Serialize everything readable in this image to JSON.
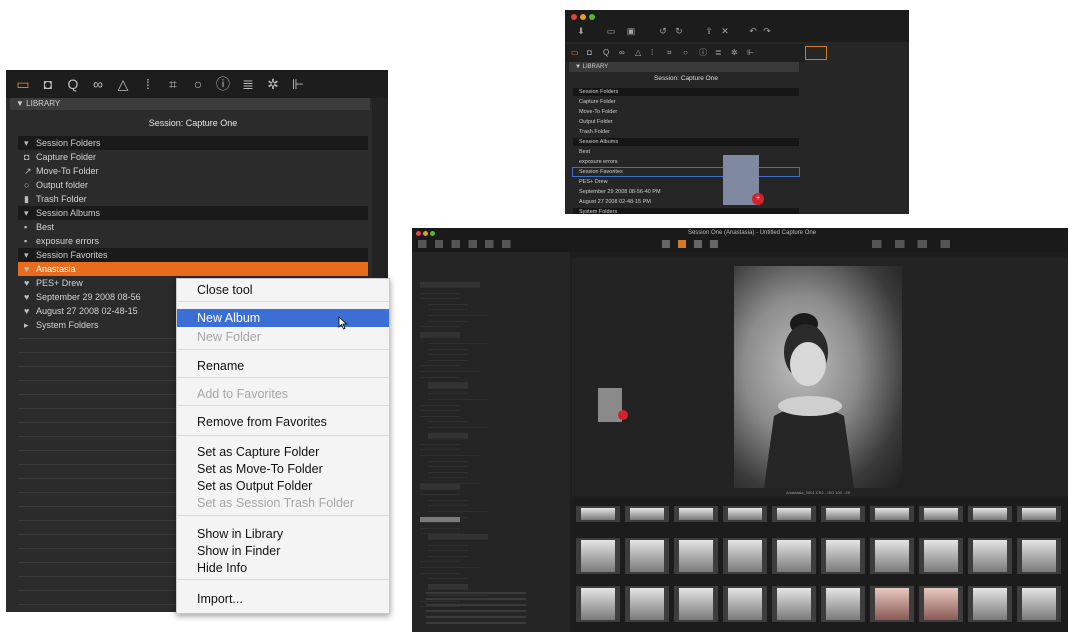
{
  "panel1": {
    "library_header": "▼ LIBRARY",
    "session_title": "Session: Capture One",
    "toolbar_icons": [
      "folder-icon",
      "camera-icon",
      "q-icon",
      "circles-icon",
      "triangle-icon",
      "pin-icon",
      "crop-icon",
      "chat-icon",
      "info-icon",
      "grid-icon",
      "gear-icon",
      "levels-icon"
    ],
    "rows": [
      {
        "label": "Session Folders",
        "kind": "group",
        "icon": "triangle-down-icon"
      },
      {
        "label": "Capture Folder",
        "kind": "item",
        "icon": "camera-icon"
      },
      {
        "label": "Move-To Folder",
        "kind": "item",
        "icon": "arrow-icon"
      },
      {
        "label": "Output folder",
        "kind": "item",
        "icon": "circle-icon"
      },
      {
        "label": "Trash Folder",
        "kind": "item",
        "icon": "trash-icon"
      },
      {
        "label": "Session Albums",
        "kind": "group",
        "icon": "triangle-down-icon"
      },
      {
        "label": "Best",
        "kind": "item",
        "icon": "album-icon"
      },
      {
        "label": "exposure errors",
        "kind": "item",
        "icon": "album-icon"
      },
      {
        "label": "Session Favorites",
        "kind": "group",
        "icon": "triangle-down-icon"
      },
      {
        "label": "Anastasia",
        "kind": "selected",
        "icon": "heart-icon"
      },
      {
        "label": "PES+ Drew",
        "kind": "item",
        "icon": "heart-icon"
      },
      {
        "label": "September 29 2008 08-56",
        "kind": "item",
        "icon": "heart-icon"
      },
      {
        "label": "August 27 2008 02-48-15",
        "kind": "item",
        "icon": "heart-icon"
      },
      {
        "label": "System Folders",
        "kind": "item",
        "icon": "triangle-right-icon"
      }
    ]
  },
  "context_menu": {
    "items": [
      {
        "label": "Close tool",
        "state": "normal"
      },
      {
        "label": "New Album",
        "state": "highlighted"
      },
      {
        "label": "New Folder",
        "state": "disabled"
      },
      {
        "label": "Rename",
        "state": "normal"
      },
      {
        "label": "Add to Favorites",
        "state": "disabled"
      },
      {
        "label": "Remove from Favorites",
        "state": "normal"
      },
      {
        "label": "Set as Capture Folder",
        "state": "normal"
      },
      {
        "label": "Set as Move-To Folder",
        "state": "normal"
      },
      {
        "label": "Set as Output Folder",
        "state": "normal"
      },
      {
        "label": "Set as Session Trash Folder",
        "state": "disabled"
      },
      {
        "label": "Show in Library",
        "state": "normal"
      },
      {
        "label": "Show in Finder",
        "state": "normal"
      },
      {
        "label": "Hide Info",
        "state": "normal"
      },
      {
        "label": "Import...",
        "state": "normal"
      }
    ]
  },
  "panel2": {
    "library_header": "▼ LIBRARY",
    "session_title": "Session: Capture One",
    "rows": [
      {
        "label": "Session Folders",
        "kind": "group"
      },
      {
        "label": "Capture Folder",
        "kind": "item"
      },
      {
        "label": "Move-To Folder",
        "kind": "item"
      },
      {
        "label": "Output Folder",
        "kind": "item"
      },
      {
        "label": "Trash Folder",
        "kind": "item"
      },
      {
        "label": "Session Albums",
        "kind": "group"
      },
      {
        "label": "Best",
        "kind": "item"
      },
      {
        "label": "exposure errors",
        "kind": "item"
      },
      {
        "label": "Session Favorites",
        "kind": "selected"
      },
      {
        "label": "PES+ Drew",
        "kind": "item"
      },
      {
        "label": "September 29 2008 08-56-40 PM",
        "kind": "item"
      },
      {
        "label": "August 27 2008 02-48-15 PM",
        "kind": "item"
      },
      {
        "label": "System Folders",
        "kind": "group"
      }
    ],
    "drag_badge": "+"
  },
  "panel3": {
    "window_title": "Session One (Anastasia) - Untitled Capture One",
    "photo_caption": "Anastasia_0001.CR2 - ISO 100 - f/8"
  },
  "colors": {
    "accent_orange": "#e76d1d",
    "highlight_blue": "#3b6fd6",
    "badge_red": "#d4222b"
  }
}
